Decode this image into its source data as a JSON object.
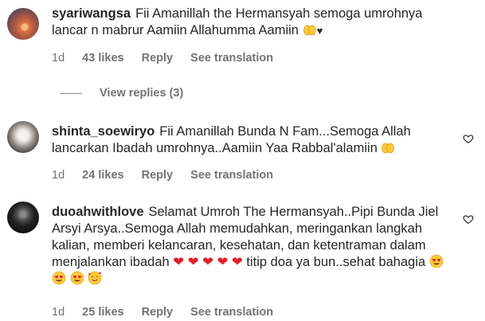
{
  "comments": [
    {
      "username": "syariwangsa",
      "text": "Fii Amanillah the Hermansyah semoga umrohnya lancar n mabrur Aamiin Allahumma Aamiin",
      "trailing_glyphs": [
        "🤲",
        "♥"
      ],
      "age": "1d",
      "likes": "43 likes",
      "reply": "Reply",
      "translation": "See translation"
    },
    {
      "username": "shinta_soewiryo",
      "text": "Fii Amanillah Bunda N Fam...Semoga Allah lancarkan Ibadah umrohnya..Aamiin Yaa Rabbal'alamiin",
      "trailing_glyphs": [
        "🤲"
      ],
      "age": "1d",
      "likes": "24 likes",
      "reply": "Reply",
      "translation": "See translation"
    },
    {
      "username": "duoahwithlove",
      "text_part1": "Selamat Umroh The Hermansyah..Pipi Bunda Jiel Arsyi Arsya..Semoga Allah memudahkan, meringankan langkah kalian, memberi kelancaran, kesehatan, dan ketentraman dalam menjalankan ibadah",
      "text_part2": "titip doa ya bun..sehat bahagia",
      "hearts": [
        "❤",
        "❤",
        "❤",
        "❤",
        "❤"
      ],
      "faces": [
        "😍",
        "😍",
        "😍",
        "🥰"
      ],
      "age": "1d",
      "likes": "25 likes",
      "reply": "Reply",
      "translation": "See translation"
    }
  ],
  "view_replies": "View replies (3)",
  "colors": {
    "text": "#262626",
    "meta": "#737373",
    "heart_red": "#e0202a",
    "emoji_yellow": "#ffc83d"
  },
  "icons": [
    "like-heart-outline-icon",
    "praying-hands-emoji",
    "heart-eyes-emoji",
    "smiling-hearts-emoji",
    "red-heart-emoji"
  ]
}
